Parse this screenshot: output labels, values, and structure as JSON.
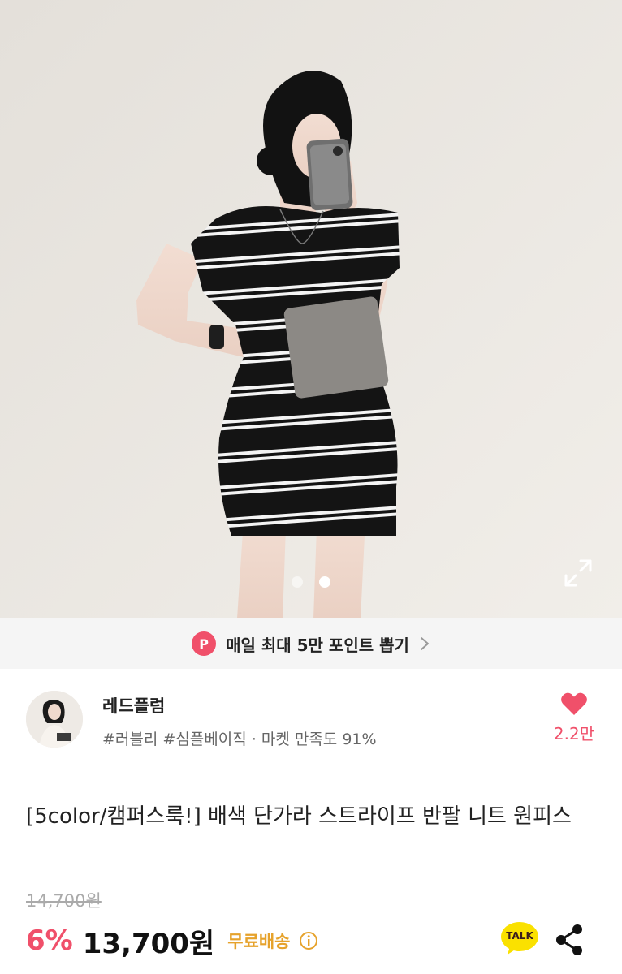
{
  "hero": {
    "image_count": 2,
    "active_index": 1
  },
  "points_banner": {
    "badge": "P",
    "text": "매일 최대 5만 포인트 뽑기"
  },
  "shop": {
    "name": "레드플럼",
    "tags": "#러블리 #심플베이직 · 마켓 만족도 91%",
    "like_count": "2.2만"
  },
  "product": {
    "title": "[5color/캠퍼스룩!] 배색 단가라 스트라이프 반팔 니트 원피스",
    "original_price": "14,700원",
    "discount": "6%",
    "price": "13,700원",
    "shipping": "무료배송"
  },
  "actions": {
    "talk_label": "TALK"
  },
  "colors": {
    "accent": "#f0506a",
    "shipping": "#e6a22b",
    "kakao": "#fae100"
  }
}
